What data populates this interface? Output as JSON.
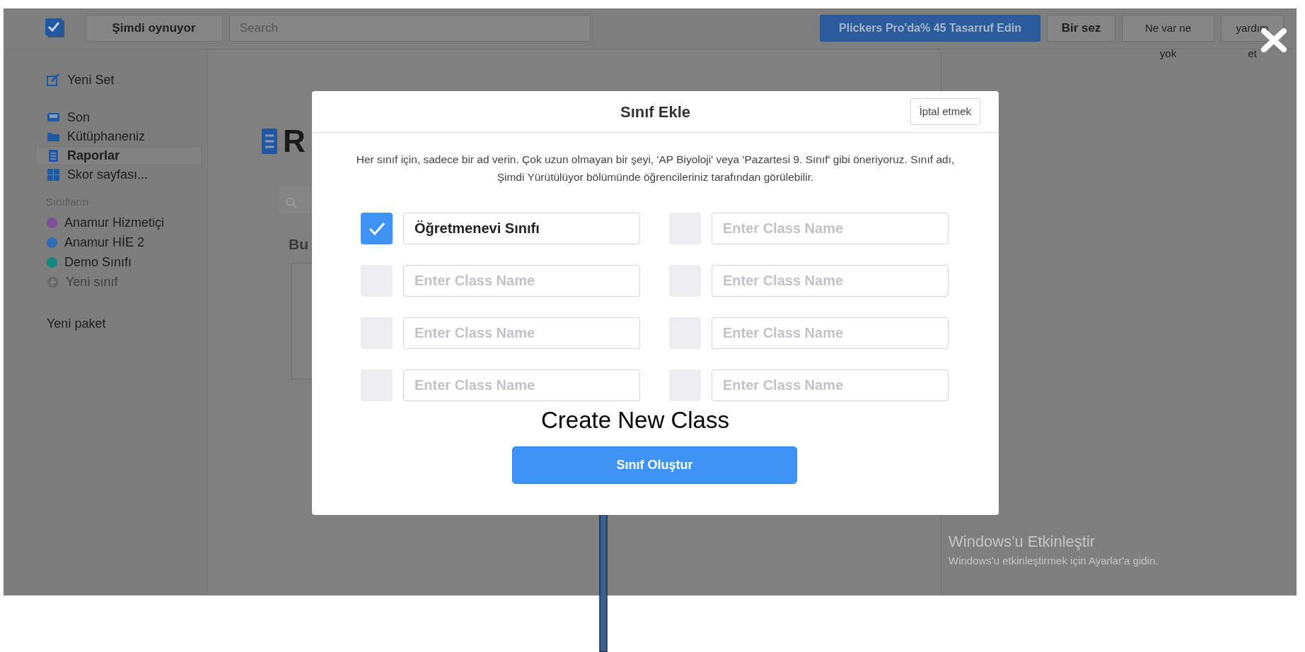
{
  "top_bar": {
    "now_playing": "Şimdi oynuyor",
    "search": {
      "placeholder": "Search"
    },
    "promo": "Plickers Pro'da% 45 Tasarruf Edin",
    "buttons": [
      "Bir sez",
      "Ne var ne yok",
      "yardım et"
    ]
  },
  "sidebar": {
    "items": [
      {
        "label": "Yeni Set",
        "kind": "new-set",
        "selected": false
      },
      {
        "label": "Son",
        "kind": "recent",
        "selected": false
      },
      {
        "label": "Kütüphaneniz",
        "kind": "library",
        "selected": false
      },
      {
        "label": "Raporlar",
        "kind": "reports",
        "selected": true
      },
      {
        "label": "Skor sayfası...",
        "kind": "scoresheet",
        "selected": false
      }
    ],
    "classes_heading": "Sınıfların",
    "classes": [
      {
        "name": "Anamur Hizmetiçi",
        "color": "#7e4f9c"
      },
      {
        "name": "Anamur HİE 2",
        "color": "#2e6bb5"
      },
      {
        "name": "Demo Sınıfı",
        "color": "#0f8a83"
      }
    ],
    "new_class": "Yeni sınıf",
    "new_pack": "Yeni paket"
  },
  "page": {
    "heading": "R",
    "section_heading": "Bu"
  },
  "modal": {
    "title": "Sınıf Ekle",
    "cancel": "İptal etmek",
    "description": "Her sınıf için, sadece bir ad verin. Çok uzun olmayan bir şeyi, 'AP Biyoloji' veya 'Pazartesi 9. Sınıf' gibi öneriyoruz. Sınıf adı, Şimdi Yürütülüyor bölümünde öğrencileriniz tarafından görülebilir.",
    "fields": [
      {
        "value": "Öğretmenevi Sınıfı",
        "checked": true
      },
      {
        "placeholder": "Enter Class Name",
        "checked": false
      },
      {
        "placeholder": "Enter Class Name",
        "checked": false
      },
      {
        "placeholder": "Enter Class Name",
        "checked": false
      },
      {
        "placeholder": "Enter Class Name",
        "checked": false
      },
      {
        "placeholder": "Enter Class Name",
        "checked": false
      },
      {
        "placeholder": "Enter Class Name",
        "checked": false
      },
      {
        "placeholder": "Enter Class Name",
        "checked": false
      }
    ],
    "submit": "Sınıf Oluştur"
  },
  "annotation": "Create New Class",
  "windows_notice": {
    "title": "Windows'u Etkinleştir",
    "subtitle": "Windows'u etkinleştirmek için Ayarlar'a gidin."
  }
}
